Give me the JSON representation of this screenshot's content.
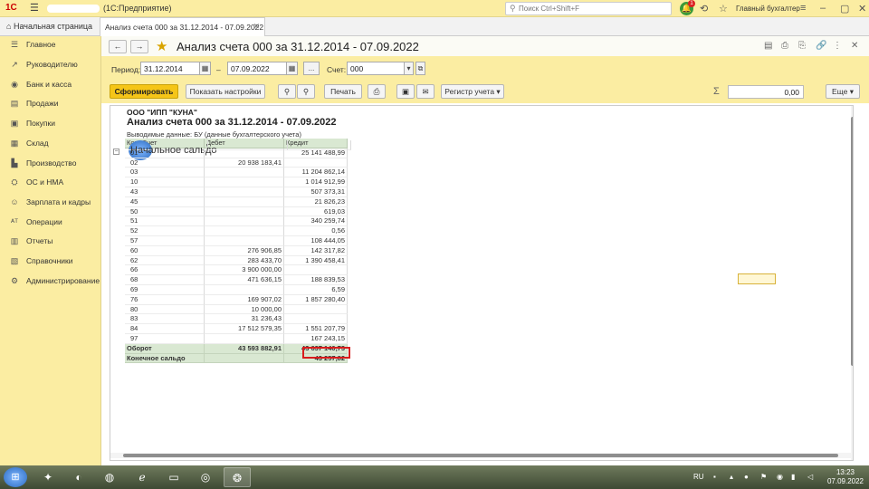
{
  "titlebar": {
    "logo": "1С",
    "app_title": "(1С:Предприятие)",
    "search_placeholder": "Поиск Ctrl+Shift+F",
    "notification_count": "1",
    "user": "Главный бухгалтер"
  },
  "tabs": {
    "home": "Начальная страница",
    "doc": "Анализ счета 000 за 31.12.2014 - 07.09.2022"
  },
  "sidebar": {
    "items": [
      {
        "label": "Главное",
        "icon": "menu-icon"
      },
      {
        "label": "Руководителю",
        "icon": "chart-icon"
      },
      {
        "label": "Банк и касса",
        "icon": "bank-icon"
      },
      {
        "label": "Продажи",
        "icon": "sales-icon"
      },
      {
        "label": "Покупки",
        "icon": "cart-icon"
      },
      {
        "label": "Склад",
        "icon": "warehouse-icon"
      },
      {
        "label": "Производство",
        "icon": "factory-icon"
      },
      {
        "label": "ОС и НМА",
        "icon": "assets-icon"
      },
      {
        "label": "Зарплата и кадры",
        "icon": "people-icon"
      },
      {
        "label": "Операции",
        "icon": "operations-icon"
      },
      {
        "label": "Отчеты",
        "icon": "reports-icon"
      },
      {
        "label": "Справочники",
        "icon": "book-icon"
      },
      {
        "label": "Администрирование",
        "icon": "gear-icon"
      }
    ]
  },
  "form": {
    "title": "Анализ счета 000 за 31.12.2014 - 07.09.2022",
    "period_label": "Период:",
    "date_from": "31.12.2014",
    "dash": "–",
    "date_to": "07.09.2022",
    "ellipsis": "...",
    "account_label": "Счет:",
    "account": "000"
  },
  "toolbar": {
    "generate": "Сформировать",
    "show_settings": "Показать настройки",
    "print": "Печать",
    "register": "Регистр учета",
    "sum_value": "0,00",
    "more": "Еще"
  },
  "report": {
    "org": "ООО \"ИПП \"КУНА\"",
    "title": "Анализ счета 000 за 31.12.2014 - 07.09.2022",
    "subtitle": "Выводимые данные: БУ (данные бухгалтерского учета)",
    "headers": [
      "Кор. Счет",
      "Дебет",
      "Кредит"
    ],
    "start_label": "Начальное сальдо",
    "rows": [
      {
        "acc": "01",
        "debit": "",
        "credit": "25 141 488,99"
      },
      {
        "acc": "02",
        "debit": "20 938 183,41",
        "credit": ""
      },
      {
        "acc": "03",
        "debit": "",
        "credit": "11 204 862,14"
      },
      {
        "acc": "10",
        "debit": "",
        "credit": "1 014 912,99"
      },
      {
        "acc": "43",
        "debit": "",
        "credit": "507 373,31"
      },
      {
        "acc": "45",
        "debit": "",
        "credit": "21 826,23"
      },
      {
        "acc": "50",
        "debit": "",
        "credit": "619,03"
      },
      {
        "acc": "51",
        "debit": "",
        "credit": "340 259,74"
      },
      {
        "acc": "52",
        "debit": "",
        "credit": "0,56"
      },
      {
        "acc": "57",
        "debit": "",
        "credit": "108 444,05"
      },
      {
        "acc": "60",
        "debit": "276 906,85",
        "credit": "142 317,82"
      },
      {
        "acc": "62",
        "debit": "283 433,70",
        "credit": "1 390 458,41"
      },
      {
        "acc": "66",
        "debit": "3 900 000,00",
        "credit": ""
      },
      {
        "acc": "68",
        "debit": "471 636,15",
        "credit": "188 839,53"
      },
      {
        "acc": "69",
        "debit": "",
        "credit": "6,59"
      },
      {
        "acc": "76",
        "debit": "169 907,02",
        "credit": "1 857 280,40"
      },
      {
        "acc": "80",
        "debit": "10 000,00",
        "credit": ""
      },
      {
        "acc": "83",
        "debit": "31 236,43",
        "credit": ""
      },
      {
        "acc": "84",
        "debit": "17 512 579,35",
        "credit": "1 551 207,79"
      },
      {
        "acc": "97",
        "debit": "",
        "credit": "167 243,15"
      }
    ],
    "turnover": {
      "label": "Оборот",
      "debit": "43 593 882,91",
      "credit": "43 637 140,73"
    },
    "end": {
      "label": "Конечное сальдо",
      "debit": "",
      "credit": "43 257,82"
    }
  },
  "taskbar": {
    "lang": "RU",
    "time": "13:23",
    "date": "07.09.2022"
  }
}
